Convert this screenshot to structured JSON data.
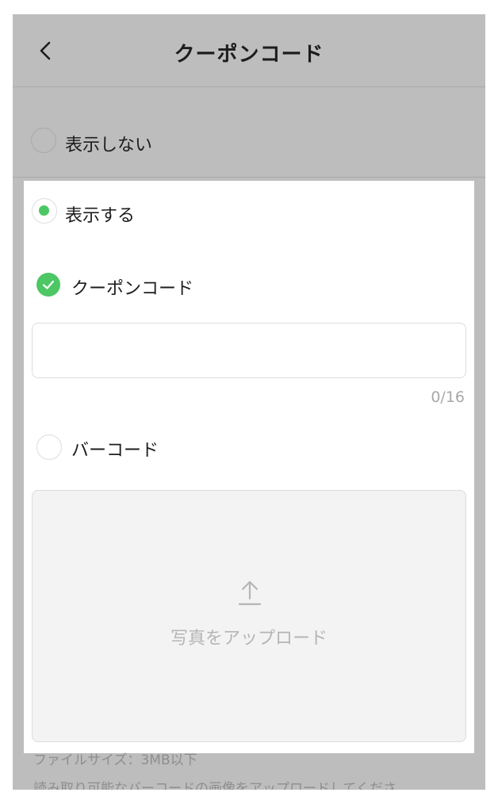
{
  "header": {
    "title": "クーポンコード",
    "back_icon": "chevron-left-icon"
  },
  "options": {
    "hide_label": "表示しない",
    "show_label": "表示する"
  },
  "coupon": {
    "label": "クーポンコード",
    "value": "",
    "counter": "0/16"
  },
  "barcode": {
    "label": "バーコード",
    "upload_label": "写真をアップロード",
    "upload_icon": "upload-arrow-icon",
    "note_size": "ファイルサイズ：3MB以下",
    "note_readable": "読み取り可能なバーコードの画像をアップロードしてくださ"
  },
  "colors": {
    "accent": "#4cc764",
    "overlay": "#bdbdbd"
  }
}
